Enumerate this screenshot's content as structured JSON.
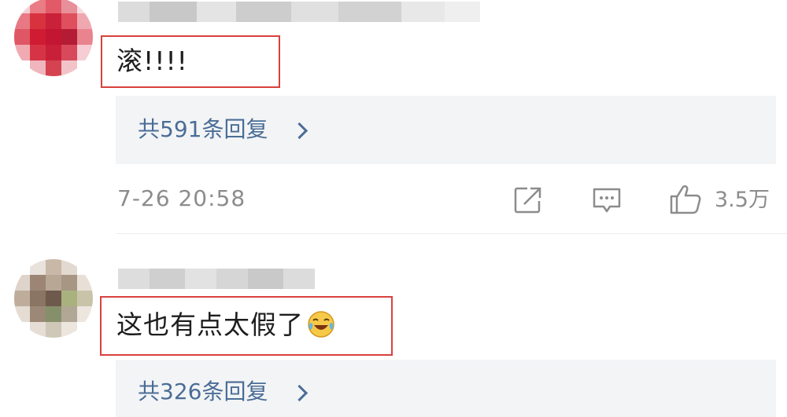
{
  "comments": [
    {
      "text": "滚!!!!",
      "replies_label": "共591条回复",
      "timestamp": "7-26 20:58",
      "like_count": "3.5万"
    },
    {
      "text": "这也有点太假了",
      "emoji": "laughing-crying-emoji",
      "replies_label": "共326条回复"
    }
  ],
  "colors": {
    "highlight_box": "#d8413e",
    "link_blue": "#4a6d96",
    "meta_gray": "#8c8c8c",
    "reply_bg": "#f3f4f6"
  }
}
